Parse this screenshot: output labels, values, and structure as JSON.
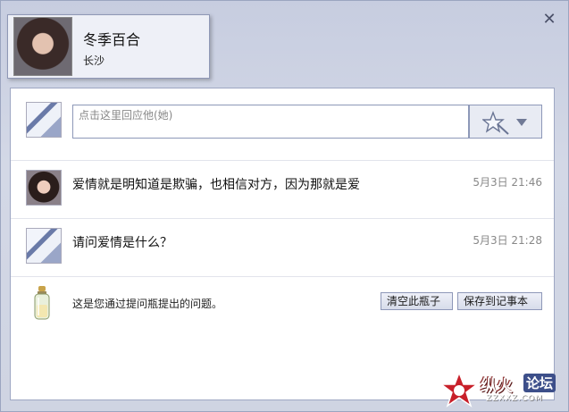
{
  "header": {
    "name": "冬季百合",
    "city": "长沙",
    "close_label": "✕"
  },
  "reply": {
    "placeholder": "点击这里回应他(她)"
  },
  "messages": [
    {
      "text": "爱情就是明知道是欺骗，也相信对方，因为那就是爱",
      "time": "5月3日 21:46"
    },
    {
      "text": "请问爱情是什么？",
      "time": "5月3日 21:28"
    }
  ],
  "footer": {
    "note": "这是您通过提问瓶提出的问题。",
    "clear_label": "清空此瓶子",
    "save_label": "保存到记事本"
  },
  "watermark": {
    "brand": "纵火",
    "badge": "论坛",
    "url": "ZZXXZ.COM"
  },
  "colors": {
    "frame": "#cfd4e2",
    "panel_border": "#9ea7c3",
    "button_bg": "#dde1ee",
    "timestamp": "#888888"
  }
}
